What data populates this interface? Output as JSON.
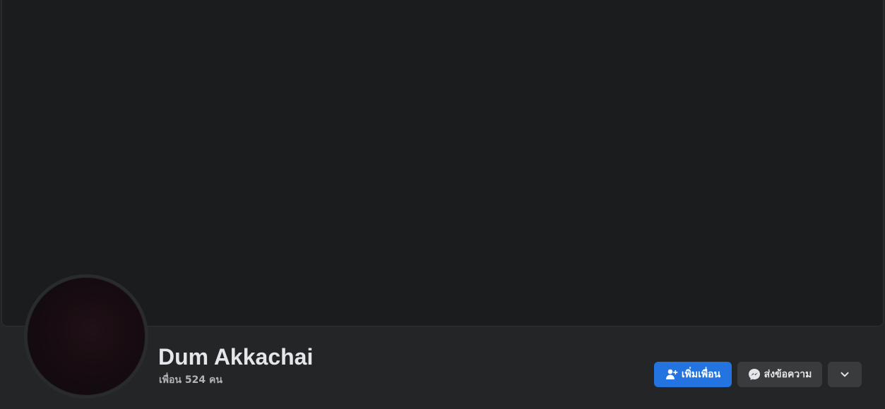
{
  "profile": {
    "name": "Dum Akkachai",
    "friends_count_text": "เพื่อน 524 คน"
  },
  "actions": {
    "add_friend_label": "เพิ่มเพื่อน",
    "add_friend_icon": "add-friend-icon",
    "message_label": "ส่งข้อความ",
    "message_icon": "messenger-icon",
    "more_icon": "chevron-down-icon"
  },
  "colors": {
    "background": "#242526",
    "cover": "#1b1c1e",
    "primary_button": "#2374e1",
    "secondary_button": "#3a3b3c",
    "text_primary": "#e4e6eb",
    "text_secondary": "#b0b3b8"
  }
}
